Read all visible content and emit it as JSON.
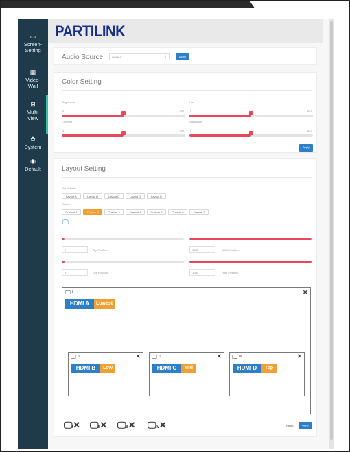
{
  "brand": {
    "logo": "PARTILINK"
  },
  "sidebar": {
    "items": [
      {
        "icon": "monitor-icon",
        "glyph": "▭",
        "label_1": "Screen-",
        "label_2": "Setting"
      },
      {
        "icon": "grid-icon",
        "glyph": "▦",
        "label_1": "Video-",
        "label_2": "Wall"
      },
      {
        "icon": "multiview-icon",
        "glyph": "⊠",
        "label_1": "Multi-",
        "label_2": "View"
      },
      {
        "icon": "gear-icon",
        "glyph": "✿",
        "label_1": "System",
        "label_2": ""
      },
      {
        "icon": "reset-icon",
        "glyph": "◉",
        "label_1": "Default",
        "label_2": ""
      }
    ],
    "active_index": 2
  },
  "audio": {
    "label": "Audio Source",
    "select_value": "HDMI A",
    "apply_label": "Apply"
  },
  "color": {
    "title": "Color Setting",
    "sliders": [
      {
        "name": "Brightness",
        "min": "0",
        "max": "100",
        "value": 50
      },
      {
        "name": "Hue",
        "min": "0",
        "max": "100",
        "value": 50
      },
      {
        "name": "Contrast",
        "min": "0",
        "max": "100",
        "value": 50
      },
      {
        "name": "Saturation",
        "min": "0",
        "max": "100",
        "value": 50
      }
    ],
    "apply_label": "Apply"
  },
  "layout": {
    "title": "Layout Setting",
    "sub_label_1": "Pre-defined",
    "sub_label_2": "Custom",
    "predefined": [
      "Layout A",
      "Layout B",
      "Layout C",
      "Layout D",
      "Layout E"
    ],
    "custom": [
      "Custom 1",
      "Custom 2",
      "Custom 3",
      "Custom 4",
      "Custom 5",
      "Custom 6",
      "Custom 7"
    ],
    "custom_active_index": 1,
    "fields": [
      {
        "value": "0",
        "label": "Top Position"
      },
      {
        "value": "1080",
        "label": "Width Position"
      },
      {
        "value": "0",
        "label": "Left Position"
      },
      {
        "value": "1080",
        "label": "High Position"
      }
    ],
    "position_levels": [
      0.02,
      1.0,
      0.02,
      1.0
    ],
    "windows": [
      {
        "id": "I",
        "source": "HDMI A",
        "layer": "Lowest"
      },
      {
        "id": "II",
        "source": "HDMI B",
        "layer": "Low"
      },
      {
        "id": "III",
        "source": "HDMI C",
        "layer": "Mid"
      },
      {
        "id": "IV",
        "source": "HDMI D",
        "layer": "Top"
      }
    ],
    "footer_windows": [
      "I",
      "II",
      "III",
      "IV"
    ],
    "reset_label": "Reset",
    "apply_label": "Apply"
  },
  "colors": {
    "accent_blue": "#2e7fc9",
    "accent_red": "#e8475c",
    "accent_orange": "#f0a030",
    "sidebar_bg": "#1f3a4a",
    "active_bar": "#2ec4a6",
    "logo": "#1a2f8a"
  }
}
